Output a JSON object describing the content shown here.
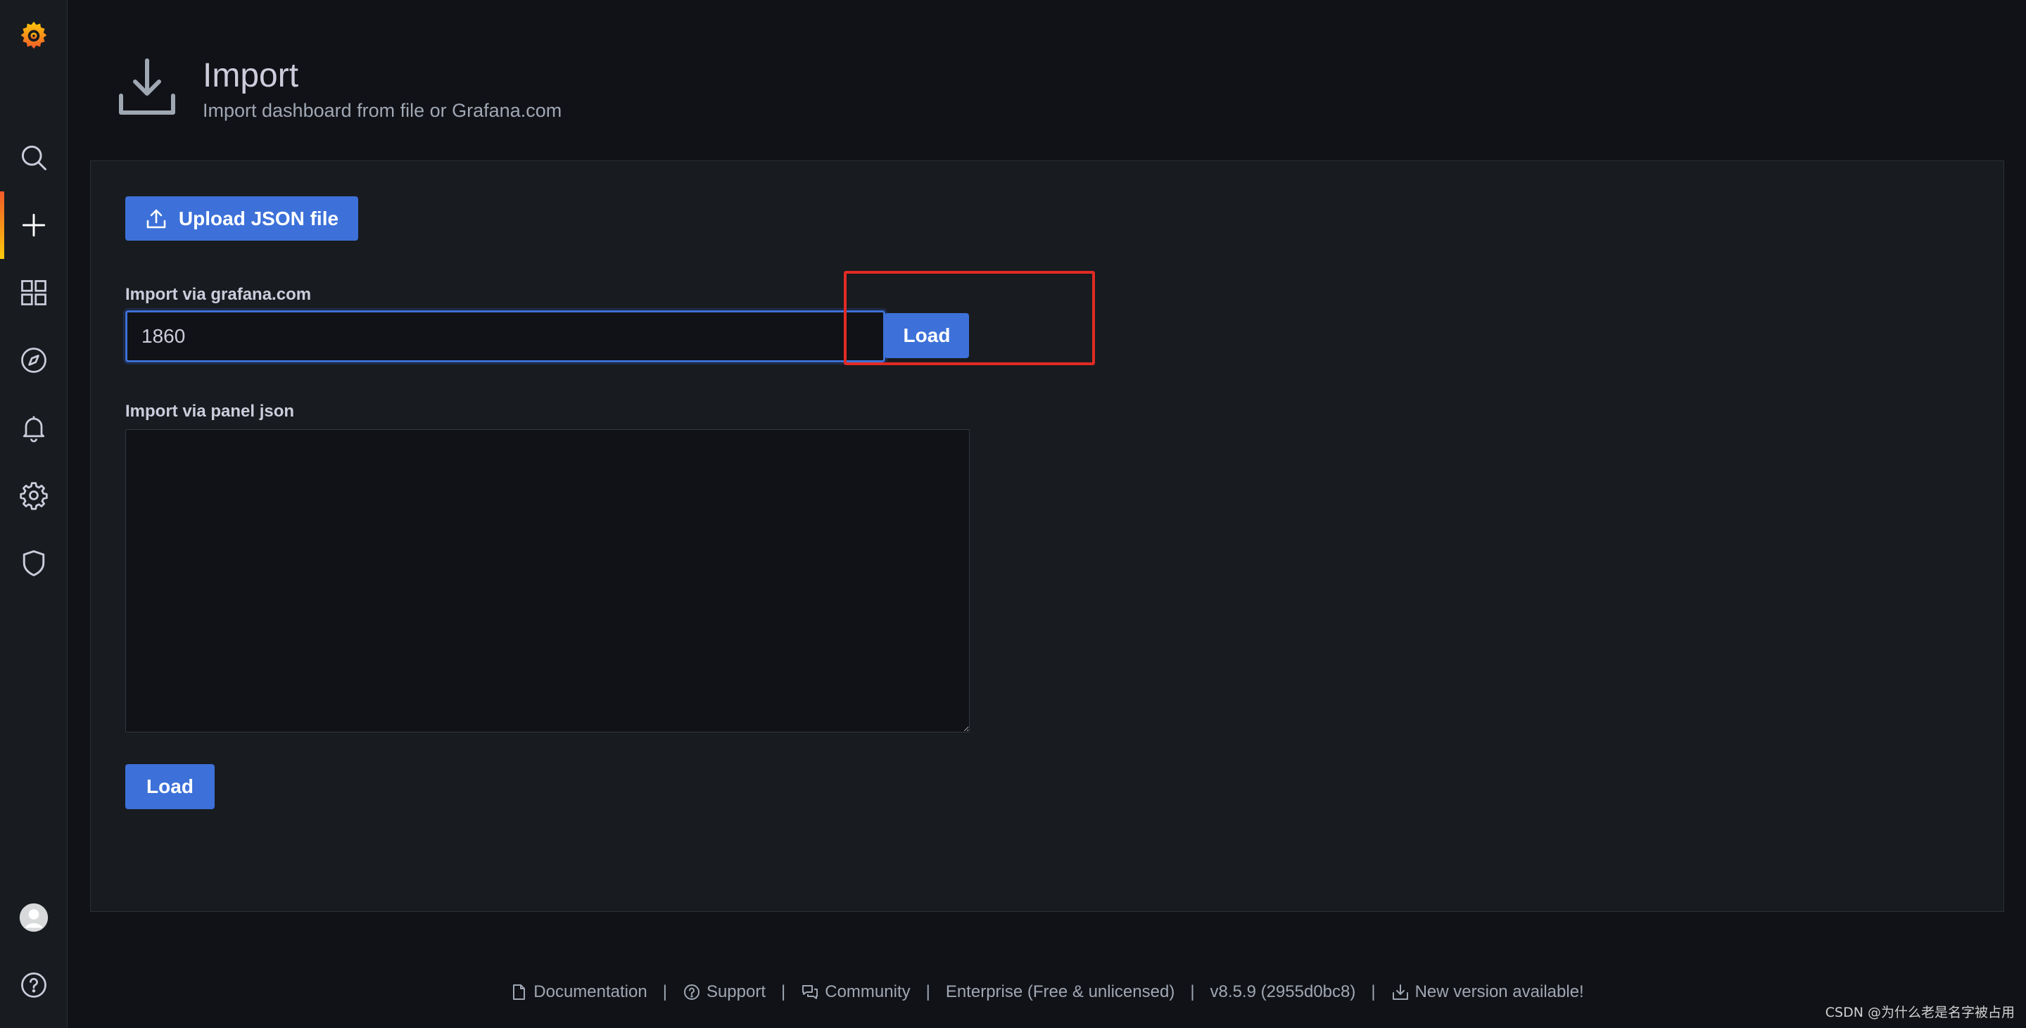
{
  "sidemenu": {
    "items": [
      {
        "name": "grafana-logo"
      },
      {
        "name": "search"
      },
      {
        "name": "create"
      },
      {
        "name": "dashboards"
      },
      {
        "name": "explore"
      },
      {
        "name": "alerting"
      },
      {
        "name": "configuration"
      },
      {
        "name": "server-admin"
      },
      {
        "name": "profile"
      },
      {
        "name": "help"
      }
    ],
    "active_color": "#f05a28"
  },
  "header": {
    "icon": "import-download-icon",
    "title": "Import",
    "subtitle": "Import dashboard from file or Grafana.com"
  },
  "import_panel": {
    "upload_button": "Upload JSON file",
    "gcom_label": "Import via grafana.com",
    "gcom_value": "1860",
    "gcom_load_button": "Load",
    "json_label": "Import via panel json",
    "json_value": "",
    "json_load_button": "Load"
  },
  "footer": {
    "documentation": "Documentation",
    "support": "Support",
    "community": "Community",
    "edition": "Enterprise (Free & unlicensed)",
    "version": "v8.5.9 (2955d0bc8)",
    "new_version": "New version available!",
    "separator": "|"
  },
  "watermark": "CSDN @为什么老是名字被占用",
  "colors": {
    "accent": "#3d71d9",
    "background": "#111217",
    "panel": "#181b1f",
    "highlight": "#e12b24"
  }
}
